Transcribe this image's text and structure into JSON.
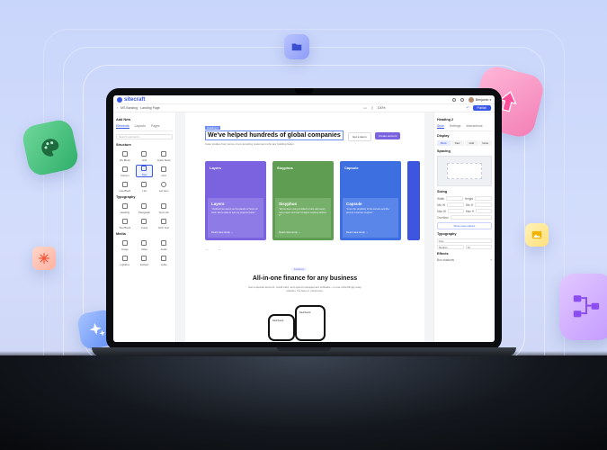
{
  "app": {
    "logo": "sitecraft",
    "breadcrumb": "MS Banking · Landing Page",
    "zoom": "100%",
    "user": "Benjamin",
    "publish_label": "Publish"
  },
  "left_panel": {
    "title": "Add New",
    "tabs": [
      "Elements",
      "Layouts",
      "Pages"
    ],
    "search_placeholder": "Search elements...",
    "sections": [
      {
        "title": "Structure",
        "items": [
          "Div Block",
          "Grid",
          "Quick Stack",
          "Column",
          "Row",
          "Grid",
          "Link Block",
          "List",
          "List Item"
        ]
      },
      {
        "title": "Typography",
        "items": [
          "Heading",
          "Paragraph",
          "Text Link",
          "Text Block",
          "Quote",
          "Rich Text"
        ]
      },
      {
        "title": "Media",
        "items": [
          "Image",
          "Video",
          "Audio",
          "Lightbox",
          "Embed",
          "Lottie"
        ]
      }
    ]
  },
  "canvas": {
    "badge": "Heading 2",
    "headline": "We've helped hundreds of global companies",
    "subline": "Case studies from some of our amazing customers who are building faster.",
    "btn_secondary": "Get a demo",
    "btn_primary": "Create account",
    "cards": [
      {
        "name": "Layers",
        "title": "Layers",
        "desc": "\"Untitled has saved us thousands of hours of work. We're able to spin up projects faster.\"",
        "link": "Read case study →",
        "color": "#7b63df",
        "inner": "#8f7be6"
      },
      {
        "name": "Sisyphus",
        "title": "Sisyphus",
        "desc": "\"We've been using Untitled to kick start every new project and can't imagine working without it.\"",
        "link": "Read case study →",
        "color": "#5f9e52",
        "inner": "#76b06a"
      },
      {
        "name": "Capsule",
        "title": "Capsule",
        "desc": "\"Love the simplicity of the service and the prompt customer support.\"",
        "link": "Read case study →",
        "color": "#3e6fe0",
        "inner": "#5a86ea"
      }
    ],
    "pill": "Features",
    "section_title": "All-in-one finance for any business",
    "section_desc": "Get a deposit account, credit card, and spend management software—in one refreshingly easy solution. No fees or minimums.",
    "phone_label": "Dashboard"
  },
  "right_panel": {
    "selected": "Heading 2",
    "tabs": [
      "Style",
      "Settings",
      "Interactions"
    ],
    "display_title": "Display",
    "display_options": [
      "Block",
      "Flex",
      "Grid",
      "None"
    ],
    "spacing_title": "Spacing",
    "sizing_title": "Sizing",
    "sizing_rows": [
      [
        "Width",
        "Height"
      ],
      [
        "Min W",
        "Min H"
      ],
      [
        "Max W",
        "Max H"
      ]
    ],
    "overflow_label": "Overflow",
    "more_label": "Show more options",
    "typography_title": "Typography",
    "font": "Inter",
    "weight": "Medium",
    "size": "16",
    "effects_title": "Effects",
    "effect_row": "Box shadows"
  }
}
